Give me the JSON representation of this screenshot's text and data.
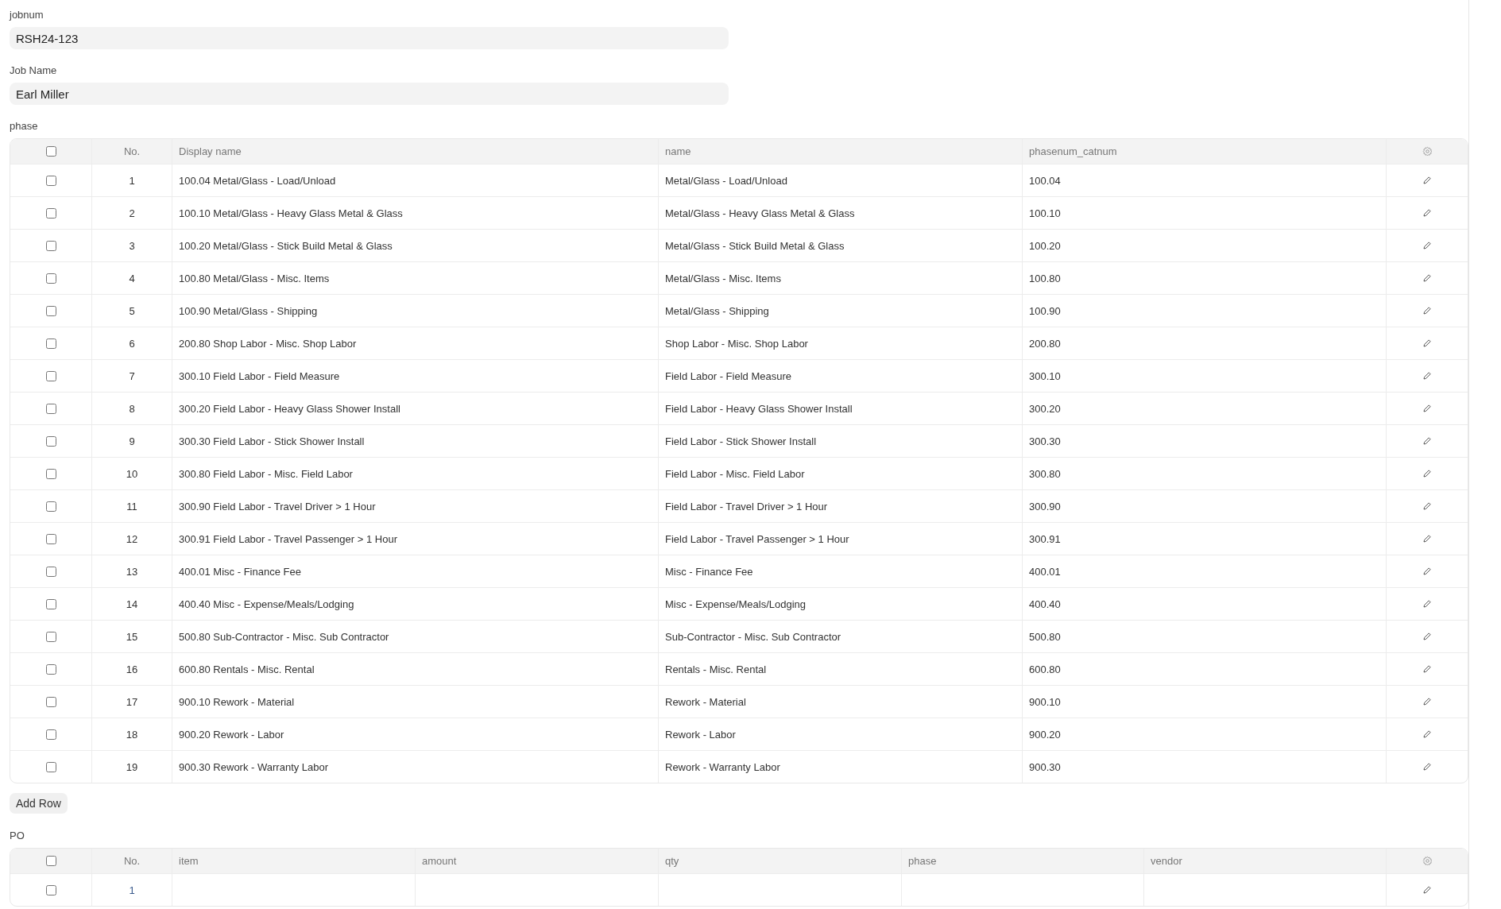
{
  "fields": [
    {
      "label": "jobnum",
      "value": "RSH24-123"
    },
    {
      "label": "Job Name",
      "value": "Earl Miller"
    }
  ],
  "phase_table": {
    "label": "phase",
    "header_checked": false,
    "columns": [
      "No.",
      "Display name",
      "name",
      "phasenum_catnum"
    ],
    "rows": [
      {
        "checked": false,
        "cells": [
          "1",
          "100.04 Metal/Glass - Load/Unload",
          "Metal/Glass - Load/Unload",
          "100.04"
        ]
      },
      {
        "checked": false,
        "cells": [
          "2",
          "100.10 Metal/Glass - Heavy Glass Metal & Glass",
          "Metal/Glass - Heavy Glass Metal & Glass",
          "100.10"
        ]
      },
      {
        "checked": false,
        "cells": [
          "3",
          "100.20 Metal/Glass - Stick Build Metal & Glass",
          "Metal/Glass - Stick Build Metal & Glass",
          "100.20"
        ]
      },
      {
        "checked": false,
        "cells": [
          "4",
          "100.80 Metal/Glass - Misc. Items",
          "Metal/Glass - Misc. Items",
          "100.80"
        ]
      },
      {
        "checked": false,
        "cells": [
          "5",
          "100.90 Metal/Glass - Shipping",
          "Metal/Glass - Shipping",
          "100.90"
        ]
      },
      {
        "checked": false,
        "cells": [
          "6",
          "200.80 Shop Labor - Misc. Shop Labor",
          "Shop Labor - Misc. Shop Labor",
          "200.80"
        ]
      },
      {
        "checked": false,
        "cells": [
          "7",
          "300.10 Field Labor - Field Measure",
          "Field Labor - Field Measure",
          "300.10"
        ]
      },
      {
        "checked": false,
        "cells": [
          "8",
          "300.20 Field Labor - Heavy Glass Shower Install",
          "Field Labor - Heavy Glass Shower Install",
          "300.20"
        ]
      },
      {
        "checked": false,
        "cells": [
          "9",
          "300.30 Field Labor - Stick Shower Install",
          "Field Labor - Stick Shower Install",
          "300.30"
        ]
      },
      {
        "checked": false,
        "cells": [
          "10",
          "300.80 Field Labor - Misc. Field Labor",
          "Field Labor - Misc. Field Labor",
          "300.80"
        ]
      },
      {
        "checked": false,
        "cells": [
          "11",
          "300.90 Field Labor - Travel Driver > 1 Hour",
          "Field Labor - Travel Driver > 1 Hour",
          "300.90"
        ]
      },
      {
        "checked": false,
        "cells": [
          "12",
          "300.91 Field Labor - Travel Passenger > 1 Hour",
          "Field Labor - Travel Passenger > 1 Hour",
          "300.91"
        ]
      },
      {
        "checked": false,
        "cells": [
          "13",
          "400.01 Misc - Finance Fee",
          "Misc - Finance Fee",
          "400.01"
        ]
      },
      {
        "checked": false,
        "cells": [
          "14",
          "400.40 Misc - Expense/Meals/Lodging",
          "Misc - Expense/Meals/Lodging",
          "400.40"
        ]
      },
      {
        "checked": false,
        "cells": [
          "15",
          "500.80 Sub-Contractor - Misc. Sub Contractor",
          "Sub-Contractor - Misc. Sub Contractor",
          "500.80"
        ]
      },
      {
        "checked": false,
        "cells": [
          "16",
          "600.80 Rentals - Misc. Rental",
          "Rentals - Misc. Rental",
          "600.80"
        ]
      },
      {
        "checked": false,
        "cells": [
          "17",
          "900.10 Rework - Material",
          "Rework - Material",
          "900.10"
        ]
      },
      {
        "checked": false,
        "cells": [
          "18",
          "900.20 Rework - Labor",
          "Rework - Labor",
          "900.20"
        ]
      },
      {
        "checked": false,
        "cells": [
          "19",
          "900.30 Rework - Warranty Labor",
          "Rework - Warranty Labor",
          "900.30"
        ]
      }
    ],
    "add_button": "Add Row"
  },
  "po_table": {
    "label": "PO",
    "header_checked": false,
    "columns": [
      "No.",
      "item",
      "amount",
      "qty",
      "phase",
      "vendor"
    ],
    "rows": [
      {
        "checked": false,
        "cells": [
          "1",
          "",
          "",
          "",
          "",
          ""
        ]
      }
    ]
  }
}
